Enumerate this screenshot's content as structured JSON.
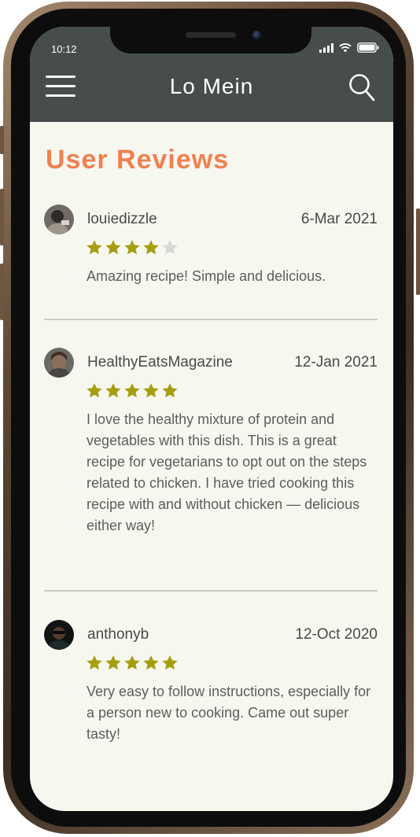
{
  "status_bar": {
    "time": "10:12"
  },
  "header": {
    "title": "Lo Mein"
  },
  "page": {
    "heading": "User Reviews"
  },
  "colors": {
    "header_bg": "#474d4b",
    "accent": "#ef8150",
    "star_filled": "#a79d11",
    "star_empty": "#d6d6d6",
    "screen_bg": "#f6f7ef"
  },
  "reviews": [
    {
      "username": "louiedizzle",
      "date": "6-Mar 2021",
      "rating": 4,
      "max_rating": 5,
      "text": "Amazing recipe! Simple and delicious."
    },
    {
      "username": "HealthyEatsMagazine",
      "date": "12-Jan 2021",
      "rating": 5,
      "max_rating": 5,
      "text": "I love the healthy mixture of protein and vegetables with this dish. This is a great recipe for vegetarians to opt out on the steps related to chicken. I have tried cooking this recipe with and without chicken — delicious either way!"
    },
    {
      "username": "anthonyb",
      "date": "12-Oct 2020",
      "rating": 5,
      "max_rating": 5,
      "text": "Very easy to follow instructions, especially for a person new to cooking. Came out super tasty!"
    }
  ]
}
